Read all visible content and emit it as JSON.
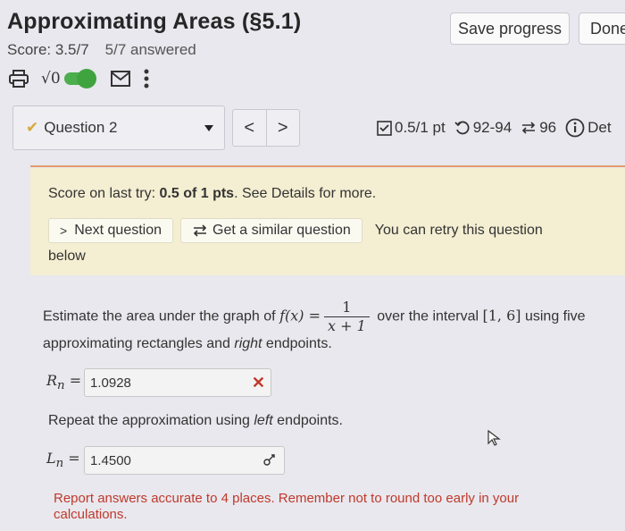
{
  "header": {
    "title": "Approximating Areas (§5.1)",
    "score": "Score: 3.5/7",
    "answered": "5/7 answered",
    "save_label": "Save progress",
    "done_label": "Done"
  },
  "toolbar": {
    "icons": [
      "printer-icon",
      "sqrt-toggle",
      "mail-icon",
      "more-icon"
    ],
    "sqrt_label": "√0",
    "toggle_on": true
  },
  "question_nav": {
    "selected": "Question 2",
    "prev": "<",
    "next": ">",
    "points": "0.5/1 pt",
    "attempts": "92-94",
    "similar": "96",
    "details": "Det"
  },
  "banner": {
    "score_prefix": "Score on last try: ",
    "score_value": "0.5 of 1 pts",
    "score_suffix": ". See Details for more.",
    "next_question": "Next question",
    "similar_question": "Get a similar question",
    "retry_1": "You can retry this question",
    "retry_2": "below"
  },
  "question": {
    "text_1": "Estimate the area under the graph of ",
    "func": "f(x) =",
    "frac_num": "1",
    "frac_den": "x + 1",
    "text_2": " over the interval ",
    "interval": "[1, 6]",
    "text_3": " using five approximating rectangles and ",
    "right": "right",
    "text_4": " endpoints.",
    "rn_label": "R",
    "rn_sub": "n",
    "rn_value": "1.0928",
    "rn_mark": "✕",
    "repeat_1": "Repeat the approximation using ",
    "left": "left",
    "repeat_2": " endpoints.",
    "ln_label": "L",
    "ln_sub": "n",
    "ln_value": "1.4500",
    "note": "Report answers accurate to 4 places. Remember not to round too early in your calculations."
  },
  "colors": {
    "accent_green": "#4cae4c",
    "banner_bg": "#f4eed2",
    "error_red": "#c0392b",
    "divider": "#e59a6b"
  }
}
